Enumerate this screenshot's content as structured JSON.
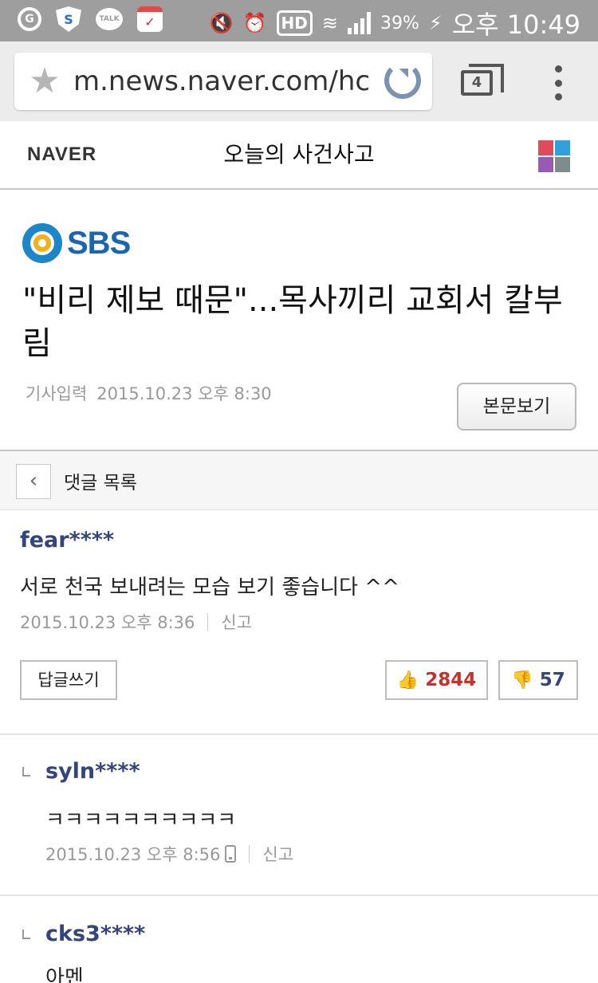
{
  "status_bar": {
    "left_icons": [
      "g-icon",
      "shield-icon",
      "talk-icon",
      "calendar-icon"
    ],
    "talk_label": "TALK",
    "g_label": "G",
    "hd_label": "HD",
    "battery": "39%",
    "time": "오후 10:49"
  },
  "browser": {
    "url": "m.news.naver.com/hc",
    "tab_count": "4"
  },
  "header": {
    "logo": "NAVER",
    "section_title": "오늘의 사건사고",
    "grid_colors": [
      "#e04a5a",
      "#34a0db",
      "#9b59b6",
      "#7f8c8d"
    ]
  },
  "article": {
    "press": "SBS",
    "headline": "\"비리 제보 때문\"...목사끼리 교회서 칼부림",
    "meta_label": "기사입력",
    "meta_date": "2015.10.23 오후 8:30",
    "view_button": "본문보기"
  },
  "comment_bar": {
    "back": "‹",
    "title": "댓글 목록"
  },
  "comments": [
    {
      "user": "fear****",
      "text": "서로 천국 보내려는 모습 보기 좋습니다 ^^",
      "date": "2015.10.23 오후 8:36",
      "report": "신고",
      "reply_button": "답글쓰기",
      "likes": "2844",
      "dislikes": "57"
    },
    {
      "user": "syln****",
      "text": "ㅋㅋㅋㅋㅋㅋㅋㅋㅋㅋ",
      "date": "2015.10.23 오후 8:56",
      "report": "신고"
    },
    {
      "user": "cks3****",
      "text": "아멘"
    }
  ],
  "colors": {
    "status_bar_bg": "#9e9e9e",
    "username": "#33457a",
    "like_count": "#c9302c",
    "sbs_blue": "#1a66b0"
  }
}
